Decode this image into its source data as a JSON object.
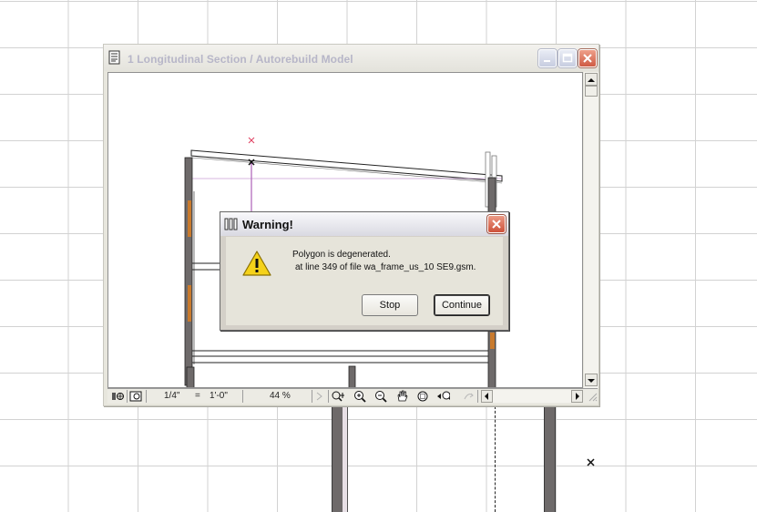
{
  "window": {
    "title": "1 Longitudinal Section / Autorebuild Model",
    "minimize_icon": "minimize-icon",
    "maximize_icon": "maximize-icon",
    "close_icon": "close-icon"
  },
  "statusbar": {
    "scale": "1/4\"",
    "equals": "=",
    "scale_value": "1'-0\"",
    "zoom": "44 %",
    "icons": [
      "view-mode-icon",
      "preview-icon",
      "zoom-in-plus-icon",
      "zoom-in-icon",
      "zoom-out-icon",
      "pan-hand-icon",
      "fit-window-icon",
      "zoom-previous-icon",
      "zoom-next-icon"
    ]
  },
  "dialog": {
    "title": "Warning!",
    "message_line1": "Polygon is degenerated.",
    "message_line2": "at line 349 of file wa_frame_us_10 SE9.gsm.",
    "stop_label": "Stop",
    "continue_label": "Continue",
    "icon": "warning-icon"
  },
  "colors": {
    "grid_line": "#d2d2d2",
    "wall_fill": "#6e6a6a",
    "wood_fill": "#c87a2d",
    "marker_red": "#e04060",
    "magenta_line": "#9b3fa8",
    "dialog_close": "#cd513a"
  }
}
